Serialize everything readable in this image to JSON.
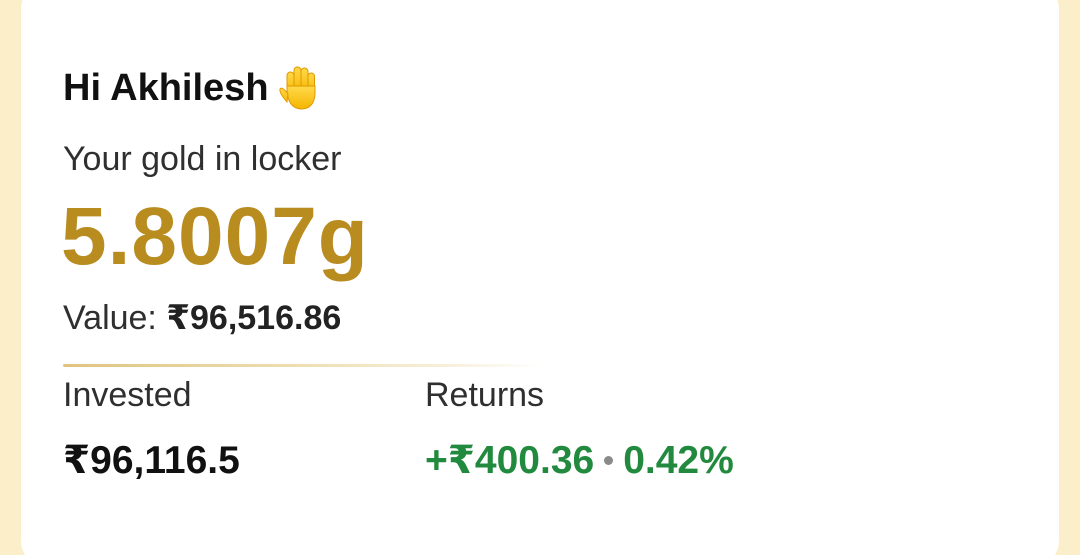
{
  "greeting": {
    "text": "Hi Akhilesh",
    "icon": "raised-hand-icon"
  },
  "locker": {
    "subtitle": "Your gold in locker",
    "gold_amount": "5.8007g",
    "value_label": "Value:",
    "value_amount": "₹96,516.86"
  },
  "stats": {
    "invested_label": "Invested",
    "invested_value": "₹96,116.5",
    "returns_label": "Returns",
    "returns_amount": "+₹400.36",
    "returns_percent": "0.42%"
  },
  "colors": {
    "gold": "#b98c20",
    "positive": "#228a3e",
    "background": "#fdf6e4"
  }
}
